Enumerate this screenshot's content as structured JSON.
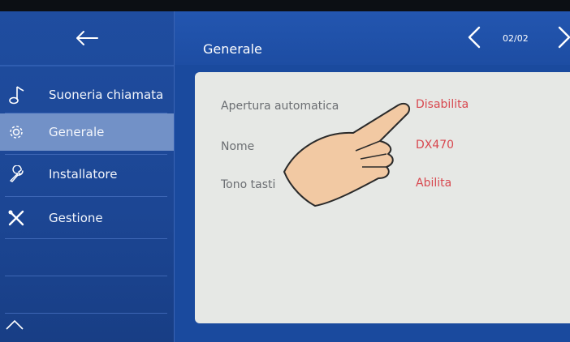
{
  "header": {
    "title": "Generale",
    "page_indicator": "02/02"
  },
  "sidebar": {
    "items": [
      {
        "label": "Suoneria chiamata",
        "icon": "music-note-icon"
      },
      {
        "label": "Generale",
        "icon": "gear-icon",
        "active": true
      },
      {
        "label": "Installatore",
        "icon": "wrench-icon"
      },
      {
        "label": "Gestione",
        "icon": "tools-icon"
      }
    ]
  },
  "settings": [
    {
      "label": "Apertura automatica",
      "value": "Disabilita"
    },
    {
      "label": "Nome",
      "value": "DX470"
    },
    {
      "label": "Tono tasti",
      "value": "Abilita"
    }
  ],
  "colors": {
    "sidebar": "#1f4da0",
    "active_item": "#7291c7",
    "panel": "#e6e8e5",
    "value_text": "#d8484f"
  }
}
